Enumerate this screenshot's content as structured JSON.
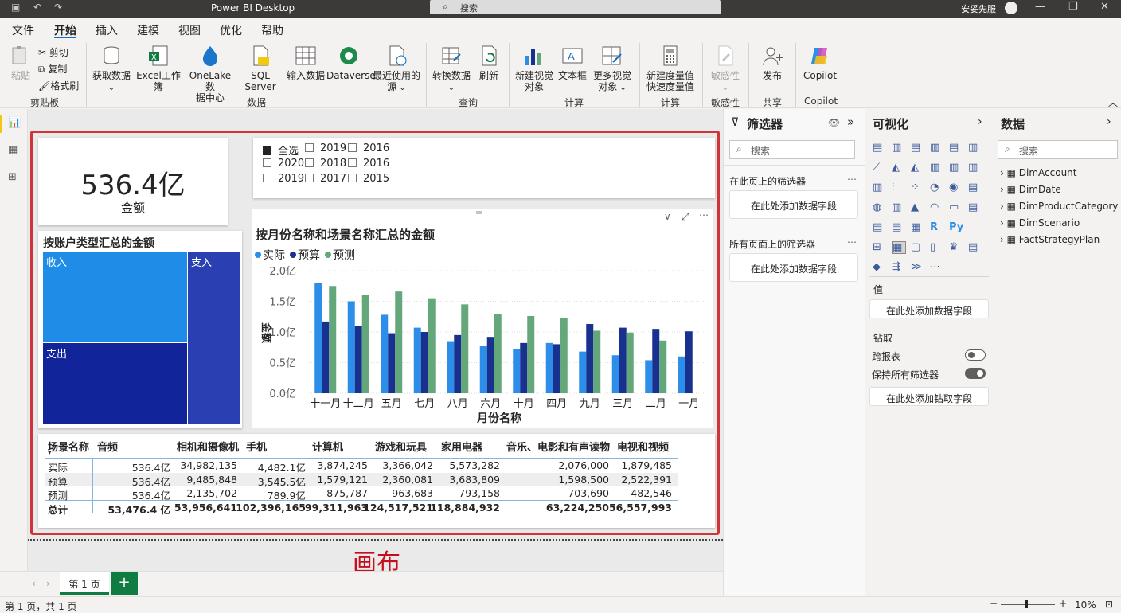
{
  "titlebar": {
    "app_title": "Power BI Desktop",
    "search_placeholder": "搜索",
    "user": "安妥先服"
  },
  "menu": {
    "items": [
      "文件",
      "开始",
      "插入",
      "建模",
      "视图",
      "优化",
      "帮助"
    ]
  },
  "ribbon": {
    "clipboard": {
      "paste": "粘贴",
      "cut": "剪切",
      "copy": "复制",
      "format_painter": "格式刷",
      "group": "剪贴板"
    },
    "data": {
      "get_data": "获取数据",
      "excel": "Excel工作簿",
      "onelake_1": "OneLake数",
      "onelake_2": "据中心",
      "sql": "SQL Server",
      "enter_data": "输入数据",
      "dataverse": "Dataverse",
      "recent_1": "最近使用的",
      "recent_2": "源",
      "group": "数据"
    },
    "query": {
      "transform": "转换数据",
      "refresh": "刷新",
      "group": "查询"
    },
    "insert": {
      "new_visual_1": "新建视觉",
      "new_visual_2": "对象",
      "textbox": "文本框",
      "more_visuals_1": "更多视觉",
      "more_visuals_2": "对象",
      "group": "计算"
    },
    "calc": {
      "quick_1": "新建度量值",
      "quick_2": "快速度量值",
      "group": "计算"
    },
    "sensitivity": {
      "label": "敏感性",
      "group": "敏感性"
    },
    "share": {
      "publish": "发布",
      "group": "共享"
    },
    "copilot": {
      "label": "Copilot",
      "group": "Copilot"
    }
  },
  "kpi": {
    "value": "536.4亿",
    "label": "金额"
  },
  "slicer": {
    "items": [
      {
        "label": "全选",
        "checked": true
      },
      {
        "label": "2019",
        "checked": false
      },
      {
        "label": "2016",
        "checked": false
      },
      {
        "label": "2020",
        "checked": false
      },
      {
        "label": "2018",
        "checked": false
      },
      {
        "label": "2016",
        "checked": false
      },
      {
        "label": "2019",
        "checked": false
      },
      {
        "label": "2017",
        "checked": false
      },
      {
        "label": "2015",
        "checked": false
      }
    ]
  },
  "treemap": {
    "title": "按账户类型汇总的金额",
    "cells": [
      "收入",
      "支出",
      "支入"
    ]
  },
  "chart_data": {
    "type": "bar",
    "title": "按月份名称和场景名称汇总的金额",
    "xlabel": "月份名称",
    "ylabel": "金额",
    "ylim": [
      0,
      2.0
    ],
    "yticks": [
      "0.0亿",
      "0.5亿",
      "1.0亿",
      "1.5亿",
      "2.0亿"
    ],
    "categories": [
      "十一月",
      "十二月",
      "五月",
      "七月",
      "八月",
      "六月",
      "十月",
      "四月",
      "九月",
      "三月",
      "二月",
      "一月"
    ],
    "series": [
      {
        "name": "实际",
        "color": "#2c8ee8",
        "values": [
          1.8,
          1.5,
          1.28,
          1.07,
          0.85,
          0.77,
          0.72,
          0.82,
          0.68,
          0.62,
          0.54,
          0.6
        ]
      },
      {
        "name": "预算",
        "color": "#18318f",
        "values": [
          1.17,
          1.1,
          0.98,
          1.0,
          0.95,
          0.92,
          0.82,
          0.8,
          1.13,
          1.07,
          1.05,
          1.01
        ]
      },
      {
        "name": "预测",
        "color": "#63a77a",
        "values": [
          1.75,
          1.6,
          1.66,
          1.55,
          1.45,
          1.29,
          1.26,
          1.23,
          1.02,
          0.99,
          0.86,
          0
        ]
      }
    ]
  },
  "table": {
    "headers": [
      "场景名称",
      "音频",
      "相机和摄像机",
      "手机",
      "计算机",
      "游戏和玩具",
      "家用电器",
      "音乐、电影和有声读物",
      "电视和视频"
    ],
    "rows": [
      {
        "label": "实际",
        "values": [
          "536.4亿",
          "34,982,135",
          "4,482.1亿",
          "3,874,245",
          "3,366,042",
          "5,573,282",
          "2,076,000",
          "1,879,485"
        ]
      },
      {
        "label": "预算",
        "values": [
          "536.4亿",
          "9,485,848",
          "3,545.5亿",
          "1,579,121",
          "2,360,081",
          "3,683,809",
          "1,598,500",
          "2,522,391"
        ]
      },
      {
        "label": "预测",
        "values": [
          "536.4亿",
          "2,135,702",
          "789.9亿",
          "875,787",
          "963,683",
          "793,158",
          "703,690",
          "482,546"
        ]
      }
    ],
    "total": {
      "label": "总计",
      "values": [
        "53,476.4 亿",
        "53,956,641",
        "102,396,165",
        "99,311,963",
        "124,517,521",
        "118,884,932",
        "63,224,250",
        "56,557,993"
      ]
    }
  },
  "canvas_caption": "画布",
  "pages": {
    "tab": "第 1 页",
    "add": "+"
  },
  "status": {
    "page_info": "第 1 页，共 1 页",
    "zoom": "10%"
  },
  "filters": {
    "title": "筛选器",
    "search": "搜索",
    "this_page": "在此页上的筛选器",
    "add_field": "在此处添加数据字段",
    "all_pages": "所有页面上的筛选器",
    "add_field2": "在此处添加数据字段"
  },
  "viz": {
    "title": "可视化",
    "values_label": "值",
    "values_add": "在此处添加数据字段",
    "drill_label": "钻取",
    "cross_report": "跨报表",
    "keep_filters": "保持所有筛选器",
    "drill_add": "在此处添加钻取字段"
  },
  "data_pane": {
    "title": "数据",
    "search": "搜索",
    "tables": [
      "DimAccount",
      "DimDate",
      "DimProductCategory",
      "DimScenario",
      "FactStrategyPlan"
    ]
  }
}
